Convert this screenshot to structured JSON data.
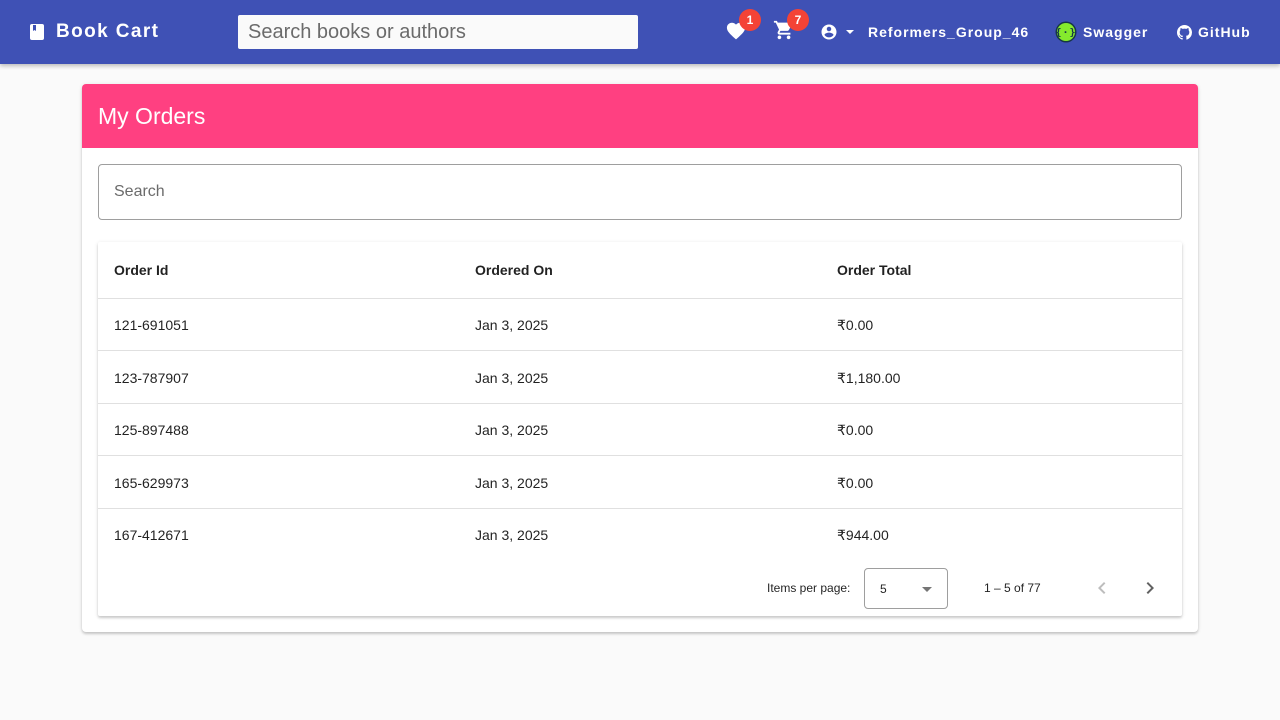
{
  "header": {
    "brand": "Book Cart",
    "search_placeholder": "Search books or authors",
    "wishlist_count": "1",
    "cart_count": "7",
    "username": "Reformers_Group_46",
    "swagger_label": "Swagger",
    "github_label": "GitHub"
  },
  "orders": {
    "title": "My Orders",
    "filter_placeholder": "Search",
    "columns": [
      "Order Id",
      "Ordered On",
      "Order Total"
    ],
    "rows": [
      {
        "id": "121-691051",
        "date": "Jan 3, 2025",
        "total": "₹0.00"
      },
      {
        "id": "123-787907",
        "date": "Jan 3, 2025",
        "total": "₹1,180.00"
      },
      {
        "id": "125-897488",
        "date": "Jan 3, 2025",
        "total": "₹0.00"
      },
      {
        "id": "165-629973",
        "date": "Jan 3, 2025",
        "total": "₹0.00"
      },
      {
        "id": "167-412671",
        "date": "Jan 3, 2025",
        "total": "₹944.00"
      }
    ],
    "paginator": {
      "items_per_page_label": "Items per page:",
      "page_size": "5",
      "range_label": "1 – 5 of 77"
    }
  },
  "colors": {
    "toolbar": "#3f51b5",
    "card_header": "#ff4081",
    "badge": "#f44336",
    "swagger_icon": "#85ea2d"
  }
}
